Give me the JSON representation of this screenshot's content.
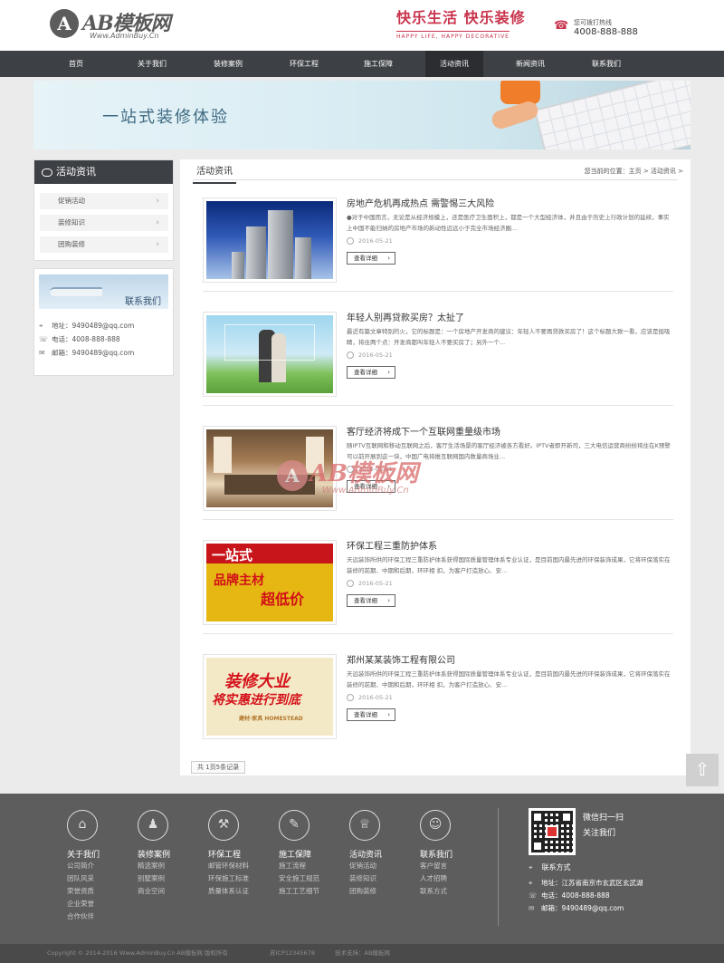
{
  "header": {
    "logo_mark": "A",
    "logo_text": "AB模板网",
    "logo_url": "Www.AdminBuy.Cn",
    "slogan_cn": "快乐生活 快乐装修",
    "slogan_en": "HAPPY LIFE, HAPPY DECORATIVE",
    "hotline_icon": "phone-icon",
    "hotline_label": "您可拨打热线",
    "hotline_number": "4008-888-888"
  },
  "nav": {
    "items": [
      {
        "label": "首页"
      },
      {
        "label": "关于我们"
      },
      {
        "label": "装修案例"
      },
      {
        "label": "环保工程"
      },
      {
        "label": "施工保障"
      },
      {
        "label": "活动资讯"
      },
      {
        "label": "新闻资讯"
      },
      {
        "label": "联系我们"
      }
    ],
    "active": "活动资讯",
    "background": "#3d4045"
  },
  "banner": {
    "text": "一站式装修体验"
  },
  "sidebar": {
    "title": "活动资讯",
    "items": [
      {
        "label": "促销活动"
      },
      {
        "label": "装修知识"
      },
      {
        "label": "团购装修"
      }
    ],
    "contact": {
      "title": "联系我们",
      "rows": [
        {
          "icon": "location-icon",
          "label": "地址：",
          "value": "9490489@qq.com"
        },
        {
          "icon": "phone-icon",
          "label": "电话：",
          "value": "4008-888-888"
        },
        {
          "icon": "mail-icon",
          "label": "邮箱：",
          "value": "9490489@qq.com"
        }
      ]
    }
  },
  "main": {
    "tab": "活动资讯",
    "breadcrumb": "您当前的位置：主页 > 活动资讯 >",
    "articles": [
      {
        "title": "房地产危机再成热点 需警惕三大风险",
        "summary": "●对于中国而言，无论是从经济规模上，还是医疗卫生面积上，都是一个大型经济体，并且由于历史上行政计划的延续，事实上中国不能归纳的房地产市场的新动性远远小于完全市场经济圈...",
        "date": "2016-05-21",
        "button": "查看详细"
      },
      {
        "title": "年轻人别再贷款买房？太扯了",
        "summary": "最近有篇文章特别的火，它的标题是：一个房地产开发商的建议：年轻人不要再贷款买房了！这个标题大致一看，应该是挺吸睛，将住两个点：开发商都叫年轻人不要买房了；另外一个...",
        "date": "2016-05-21",
        "button": "查看详细"
      },
      {
        "title": "客厅经济将成下一个互联网重量级市场",
        "summary": "随IPTV互联网和移动互联网之后，客厅生活场景的客厅经济被各方看好。IPTV者即开新司，三大电信运营商纷纷将住在K预警可以前开展到这一块，中国广电将推互联网国内数量商场业...",
        "date": "2016-05-21",
        "button": "查看详细"
      },
      {
        "title": "环保工程三重防护体系",
        "summary": "天远装饰所供的环保工程三重防护体系获得国际质量管理体系专业认证，是目前国内最先进的环保装饰成果，它将环保落实在装修的前期、中期和后期，环环相 扣，为客户打造放心、安...",
        "date": "2016-05-21",
        "button": "查看详细"
      },
      {
        "title": "郑州某某装饰工程有限公司",
        "summary": "天远装饰所供的环保工程三重防护体系获得国际质量管理体系专业认证，是目前国内最先进的环保装饰成果，它将环保落实在装修的前期、中期和后期，环环相 扣，为客户打造放心、安...",
        "date": "2016-05-21",
        "button": "查看详细"
      }
    ],
    "thumb4_line1": "一站式",
    "thumb4_line2": "品牌主材",
    "thumb4_line3": "超低价",
    "thumb5_line1": "装修大业",
    "thumb5_line2": "将实惠进行到底",
    "thumb5_line3": "建材·家具  HOMESTEAD",
    "pager": "共 1页5条记录"
  },
  "watermark": {
    "mark": "A",
    "text": "AB模板网",
    "url": "Www.AdminBuy.Cn"
  },
  "backtop_icon": "arrow-up-icon",
  "footer": {
    "columns": [
      {
        "icon": "building-icon",
        "glyph": "⌂",
        "title": "关于我们",
        "links": [
          "公司简介",
          "团队风采",
          "荣誉资质",
          "企业荣誉",
          "合作伙伴"
        ]
      },
      {
        "icon": "badge-icon",
        "glyph": "♟",
        "title": "装修案例",
        "links": [
          "精选案例",
          "别墅案例",
          "商业空间"
        ]
      },
      {
        "icon": "paint-roller-icon",
        "glyph": "⚒",
        "title": "环保工程",
        "links": [
          "邮管环保材料",
          "环保施工标准",
          "质量体系认证"
        ]
      },
      {
        "icon": "hammer-icon",
        "glyph": "✎",
        "title": "施工保障",
        "links": [
          "施工流程",
          "安全施工规范",
          "施工工艺细节"
        ]
      },
      {
        "icon": "trophy-icon",
        "glyph": "♕",
        "title": "活动资讯",
        "links": [
          "促销活动",
          "装修知识",
          "团购装修"
        ]
      },
      {
        "icon": "user-icon",
        "glyph": "☺",
        "title": "联系我们",
        "links": [
          "客户留言",
          "人才招聘",
          "联系方式"
        ]
      }
    ],
    "scan_line1": "微信扫一扫",
    "scan_line2": "关注我们",
    "contact_title": "联系方式",
    "contact_rows": [
      {
        "icon": "location-icon",
        "text": "地址：江苏省南京市玄武区玄武湖"
      },
      {
        "icon": "phone-icon",
        "text": "电话：4008-888-888"
      },
      {
        "icon": "mail-icon",
        "text": "邮箱：9490489@qq.com"
      }
    ],
    "copyright_1": "Copyright © 2014-2016 Www.AdminBuy.Cn AB模板网 版权所有",
    "copyright_2": "苏ICP12345678",
    "copyright_3": "技术支持：AB模板网"
  }
}
